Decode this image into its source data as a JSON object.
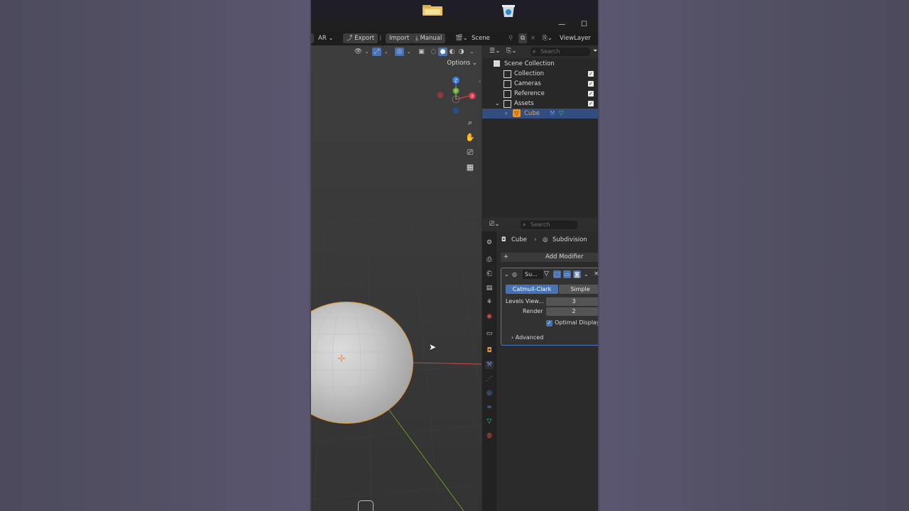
{
  "topbar": {
    "mode": "AR",
    "export_label": "Export",
    "import_label": "Import",
    "manual_label": "Manual",
    "scene_label": "Scene",
    "viewlayer_label": "ViewLayer"
  },
  "viewport": {
    "options_label": "Options",
    "gizmo": {
      "z": "Z",
      "x": "X",
      "y": "Y"
    }
  },
  "outliner": {
    "search_placeholder": "Search",
    "items": [
      {
        "label": "Scene Collection"
      },
      {
        "label": "Collection",
        "checked": true
      },
      {
        "label": "Cameras",
        "checked": true
      },
      {
        "label": "Reference",
        "checked": true
      },
      {
        "label": "Assets",
        "checked": true
      },
      {
        "label": "Cube",
        "selected": true
      }
    ]
  },
  "properties": {
    "search_placeholder": "Search",
    "breadcrumb": {
      "object": "Cube",
      "modifier": "Subdivision"
    },
    "add_modifier_label": "Add Modifier",
    "modifier": {
      "name": "Su...",
      "mode_catmull": "Catmull-Clark",
      "mode_simple": "Simple",
      "levels_viewport_label": "Levels View...",
      "levels_viewport_value": "3",
      "render_label": "Render",
      "render_value": "2",
      "optimal_display_label": "Optimal Display",
      "optimal_display_checked": true,
      "advanced_label": "Advanced"
    }
  },
  "colors": {
    "accent": "#4772b3",
    "selected_row": "#334d80",
    "active_object": "#e8952f"
  }
}
